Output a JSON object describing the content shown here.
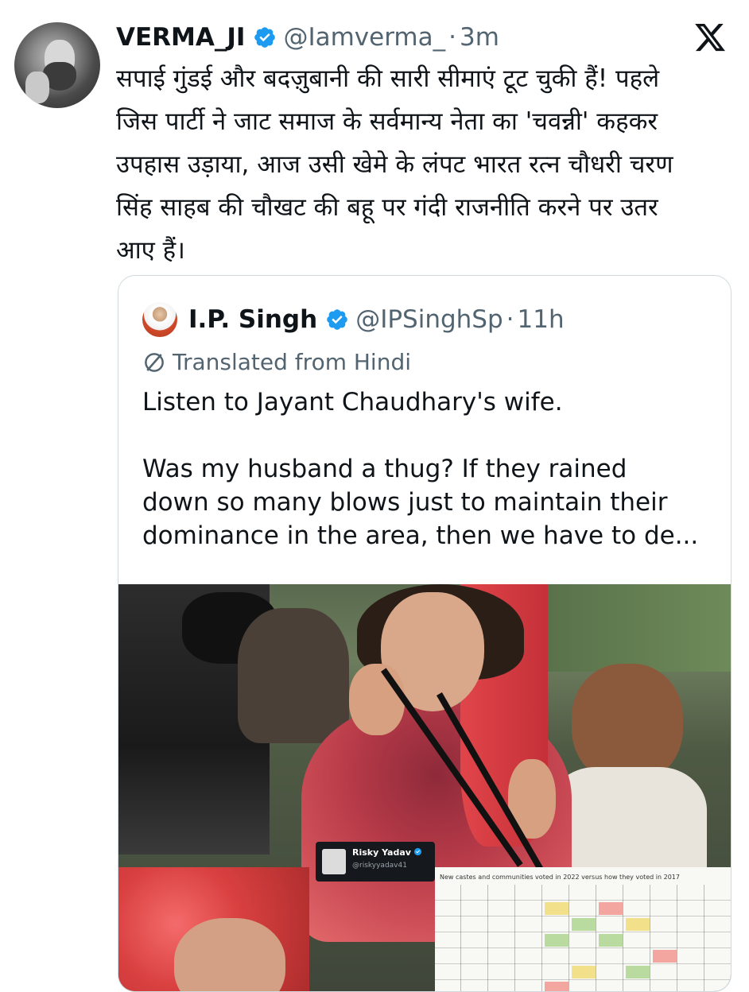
{
  "tweet": {
    "author_name": "VERMA_JI",
    "author_handle": "@Iamverma_",
    "separator": "·",
    "time": "3m",
    "text_lines": [
      "सपाई गुंडई और बदज़ुबानी की सारी सीमाएं टूट चुकी हैं! पहले",
      "जिस पार्टी ने जाट समाज के सर्वमान्य नेता का 'चवन्नी' कहकर",
      "उपहास उड़ाया, आज उसी खेमे के लंपट भारत रत्न चौधरी चरण",
      "सिंह साहब की चौखट की बहू पर गंदी राजनीति करने पर उतर",
      "आए हैं।"
    ]
  },
  "quoted_tweet": {
    "author_name": "I.P. Singh",
    "author_handle": "@IPSinghSp",
    "separator": "·",
    "time": "11h",
    "translated_label": "Translated from Hindi",
    "text_para1": "Listen to Jayant Chaudhary's wife.",
    "text_para2_lines": [
      "Was my husband a thug? If they rained",
      "down so many blows just to maintain their",
      "dominance in the area, then we have to de..."
    ]
  },
  "media_overlay": {
    "name": "Risky Yadav",
    "handle": "@riskyyadav41",
    "table_caption": "New castes and communities voted in 2022 versus how they voted in 2017"
  },
  "colors": {
    "verified_blue": "#1d9bf0",
    "secondary_text": "#536471",
    "border": "#cfd9de"
  },
  "icons": {
    "verified": "verified-badge-icon",
    "platform_logo": "x-logo-icon",
    "translate": "translate-icon"
  }
}
